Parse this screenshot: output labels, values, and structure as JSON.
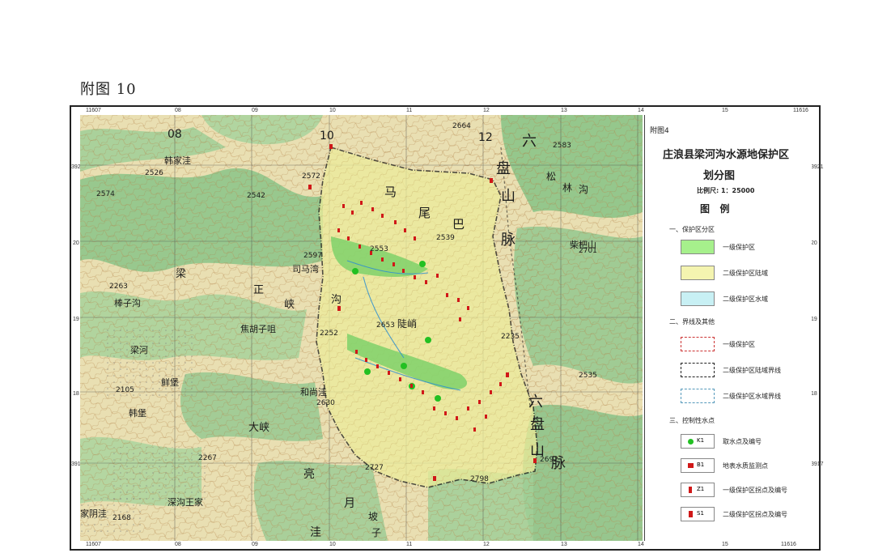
{
  "page": {
    "title": "附图 10"
  },
  "frame": {
    "top_ticks": [
      "11607",
      "08",
      "09",
      "10",
      "11",
      "12",
      "13",
      "14",
      "15",
      "11616"
    ],
    "bottom_ticks": [
      "11607",
      "08",
      "09",
      "10",
      "11",
      "12",
      "13",
      "14",
      "15",
      "11616"
    ],
    "left_ticks": [
      "3921",
      "20",
      "19",
      "18",
      "3917"
    ],
    "right_ticks": [
      "3921",
      "20",
      "19",
      "18",
      "3917"
    ]
  },
  "legend": {
    "corner_note": "附图4",
    "title_line1": "庄浪县梁河沟水源地保护区",
    "title_line2": "划分图",
    "scale": "比例尺: 1：25000",
    "heading": "图   例",
    "section1": "一、保护区分区",
    "zone1": "一级保护区",
    "zone2": "二级保护区陆域",
    "zone3": "二级保护区水域",
    "section2": "二、界线及其他",
    "line1": "一级保护区",
    "line2": "二级保护区陆域界线",
    "line3": "二级保护区水域界线",
    "section3": "三、控制性水点",
    "pt1": "取水点及编号",
    "pt2": "地表水质监测点",
    "pt3": "一级保护区拐点及编号",
    "pt4": "二级保护区拐点及编号",
    "pt1_code": "K1",
    "pt2_code": "B1",
    "pt3_code": "Z1",
    "pt4_code": "S1",
    "colors": {
      "zone1": "#a6f08c",
      "zone2": "#f4f4b0",
      "zone3": "#c8f0f4",
      "boundary": "#1a1a1a",
      "intake": "#22c022",
      "marker": "#d01818"
    }
  },
  "map": {
    "labels": [
      "08",
      "10",
      "12",
      "六",
      "盘",
      "山",
      "脉",
      "六",
      "盘",
      "山",
      "脉",
      "马",
      "尾",
      "巴",
      "松",
      "林",
      "沟",
      "柴杷山",
      "司马湾",
      "正",
      "峡",
      "沟",
      "焦胡子咀",
      "陡峭",
      "梁河",
      "鲜堡",
      "韩堡",
      "和尚洼",
      "大峡",
      "深沟王家",
      "家阴洼",
      "亮",
      "月",
      "洼",
      "坡",
      "子",
      "棒子沟",
      "韩家洼",
      "梁",
      "2574",
      "2526",
      "2572",
      "2542",
      "2597",
      "2553",
      "2539",
      "2583",
      "2263",
      "2252",
      "2653",
      "2235",
      "2535",
      "2105",
      "2630",
      "2267",
      "2168",
      "2727",
      "2798",
      "2692",
      "2701",
      "2664"
    ]
  }
}
